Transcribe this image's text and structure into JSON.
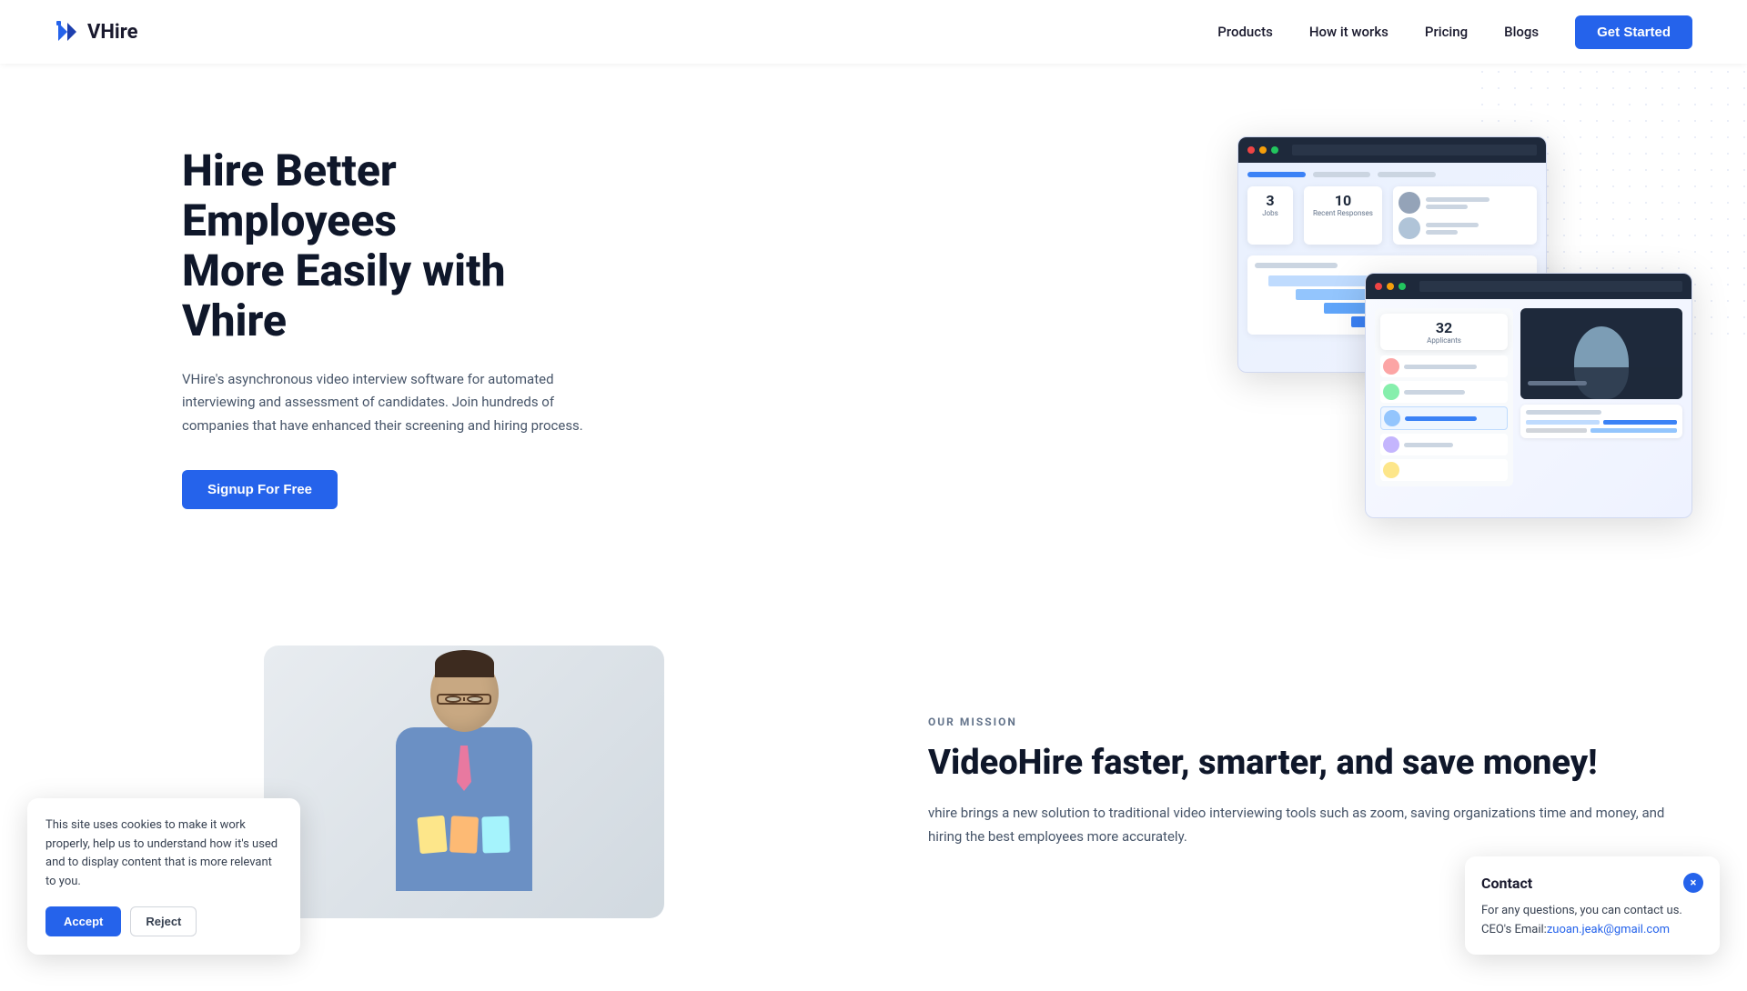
{
  "brand": {
    "name": "VHire",
    "logo_text": "VHire"
  },
  "navbar": {
    "products_label": "Products",
    "how_it_works_label": "How it works",
    "pricing_label": "Pricing",
    "blogs_label": "Blogs",
    "cta_label": "Get Started"
  },
  "hero": {
    "title_line1": "Hire Better Employees",
    "title_line2": "More Easily with Vhire",
    "description": "VHire's asynchronous video interview software for automated interviewing and assessment of candidates. Join hundreds of companies that have enhanced their screening and hiring process.",
    "cta_label": "Signup For Free"
  },
  "mission": {
    "section_label": "OUR MISSION",
    "title": "VideoHire faster, smarter, and save money!",
    "description": "vhire brings a new solution to traditional video interviewing tools such as zoom, saving organizations time and money, and hiring the best employees more accurately."
  },
  "cookie_banner": {
    "text": "This site uses cookies to make it work properly, help us to understand how it's used and to display content that is more relevant to you.",
    "accept_label": "Accept",
    "reject_label": "Reject"
  },
  "contact_widget": {
    "title": "Contact",
    "body_text": "For any questions, you can contact us.\nCEO's Email:",
    "email": "zuoan.jeak@gmail.com",
    "close_icon": "×"
  },
  "mock_stats": {
    "stat1_num": "3",
    "stat1_label": "Jobs",
    "stat2_num": "10",
    "stat2_label": "Recent Responses",
    "stat3_num": "32",
    "stat3_label": "Applicants"
  }
}
